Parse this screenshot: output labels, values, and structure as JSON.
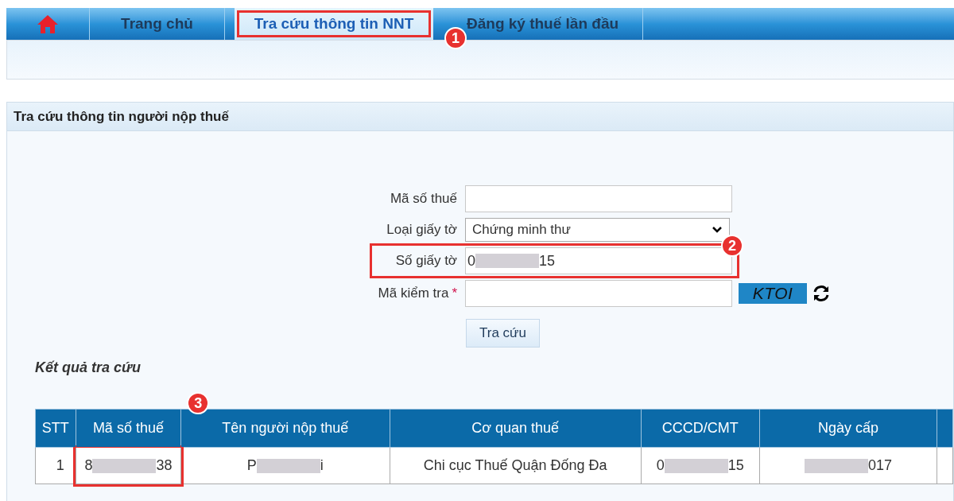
{
  "tabs": [
    {
      "kind": "home",
      "selected": false
    },
    {
      "kind": "text",
      "label": "Trang chủ",
      "selected": false
    },
    {
      "kind": "text",
      "label": "Tra cứu thông tin NNT",
      "selected": true,
      "marker": "1"
    },
    {
      "kind": "text",
      "label": "Đăng ký thuế lần đầu",
      "selected": false
    }
  ],
  "panel": {
    "title": "Tra cứu thông tin người nộp thuế"
  },
  "form": {
    "fields": [
      {
        "kind": "input",
        "label": "Mã số thuế"
      },
      {
        "kind": "select",
        "label": "Loại giấy tờ",
        "value": "Chứng minh thư"
      },
      {
        "kind": "input",
        "label": "Số giấy tờ",
        "marker": "2",
        "value": [
          {
            "kind": "text",
            "text": "0"
          },
          {
            "kind": "redacted"
          },
          {
            "kind": "text",
            "text": "15"
          }
        ]
      },
      {
        "kind": "captcha",
        "label": "Mã kiểm tra",
        "required_mark": "*",
        "captcha": "KTOI"
      }
    ],
    "button": "Tra cứu"
  },
  "results": {
    "title": "Kết quả tra cứu",
    "columns": [
      {
        "label": "STT"
      },
      {
        "label": "Mã số thuế",
        "marker": "3"
      },
      {
        "label": "Tên người nộp thuế"
      },
      {
        "label": "Cơ quan thuế"
      },
      {
        "label": "CCCD/CMT"
      },
      {
        "label": "Ngày cấp"
      }
    ],
    "rows": [
      [
        [
          {
            "kind": "text",
            "text": "1"
          }
        ],
        [
          {
            "kind": "text",
            "text": "8"
          },
          {
            "kind": "redacted"
          },
          {
            "kind": "text",
            "text": "38"
          }
        ],
        [
          {
            "kind": "text",
            "text": "P"
          },
          {
            "kind": "redacted"
          },
          {
            "kind": "text",
            "text": "i"
          }
        ],
        [
          {
            "kind": "text",
            "text": "Chi cục Thuế Quận Đống Đa"
          }
        ],
        [
          {
            "kind": "text",
            "text": "0"
          },
          {
            "kind": "redacted"
          },
          {
            "kind": "text",
            "text": "15"
          }
        ],
        [
          {
            "kind": "redacted"
          },
          {
            "kind": "text",
            "text": "017"
          }
        ]
      ]
    ]
  }
}
